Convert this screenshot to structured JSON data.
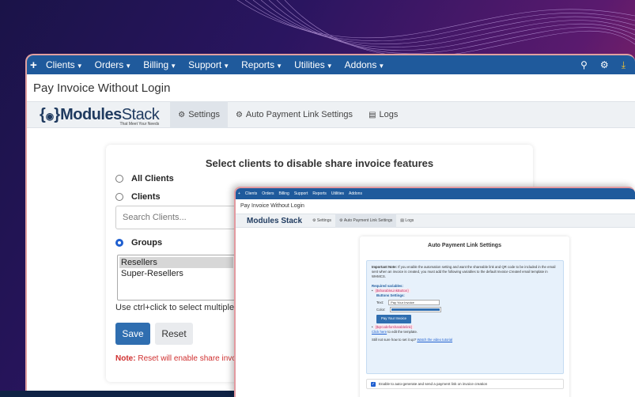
{
  "nav": {
    "plus": "+",
    "items": [
      {
        "label": "Clients"
      },
      {
        "label": "Orders"
      },
      {
        "label": "Billing"
      },
      {
        "label": "Support"
      },
      {
        "label": "Reports"
      },
      {
        "label": "Utilities"
      },
      {
        "label": "Addons"
      }
    ],
    "right_icons": [
      "search-icon",
      "gears-icon",
      "download-icon"
    ]
  },
  "page": {
    "title": "Pay Invoice Without Login"
  },
  "logo": {
    "main": "Modules",
    "stack": "Stack",
    "tagline": "That Meet Your Needs"
  },
  "tabs": [
    {
      "label": "Settings",
      "icon": "gear-icon"
    },
    {
      "label": "Auto Payment Link Settings",
      "icon": "gear-icon"
    },
    {
      "label": "Logs",
      "icon": "list-icon"
    }
  ],
  "main_card": {
    "title": "Select clients to disable share invoice features",
    "options": [
      {
        "label": "All Clients",
        "selected": false
      },
      {
        "label": "Clients",
        "selected": false
      },
      {
        "label": "Groups",
        "selected": true
      }
    ],
    "search_placeholder": "Search Clients...",
    "groups": [
      {
        "label": "Resellers",
        "selected": true
      },
      {
        "label": "Super-Resellers",
        "selected": false
      }
    ],
    "hint": "Use ctrl+click to select multiple groups",
    "save_label": "Save",
    "reset_label": "Reset",
    "note_label": "Note:",
    "note_text": " Reset will enable share invoice fe"
  },
  "second_window": {
    "nav": [
      "Clients",
      "Orders",
      "Billing",
      "Support",
      "Reports",
      "Utilities",
      "Addons"
    ],
    "title": "Pay Invoice Without Login",
    "logo": "Modules Stack",
    "tabs": [
      "Settings",
      "Auto Payment Link Settings",
      "Logs"
    ],
    "card_title": "Auto Payment Link Settings",
    "important_label": "Important Note:",
    "important_text": " If you enable the automation setting and want the shareable link and QR code to be included in the email sent when an invoice is created, you must add the following variables to the default ",
    "template_name": "Invoice Created",
    "important_tail": " email template in WHMCS.",
    "required_label": "Required variables:",
    "var1": "{$sharableLinkButton}",
    "buttons_settings": "Buttons Settings:",
    "text_label": "Text:",
    "text_value": "Pay Your Invoice",
    "color_label": "Color:",
    "button_preview": "Pay Your Invoice",
    "var2": "{$qrcodeforsharablelink}",
    "click_here": "Click here",
    "edit_text": " to edit the template.",
    "not_sure": "Still not sure how to set it up? ",
    "video_link": "Watch the video tutorial",
    "checkbox_label": "Enable to auto-generate and send a payment link on invoice creation"
  },
  "colors": {
    "nav_bg": "#1f5a9c",
    "save_btn": "#2f6eb0",
    "note": "#d03030",
    "accent_radio": "#1f5fd0"
  }
}
